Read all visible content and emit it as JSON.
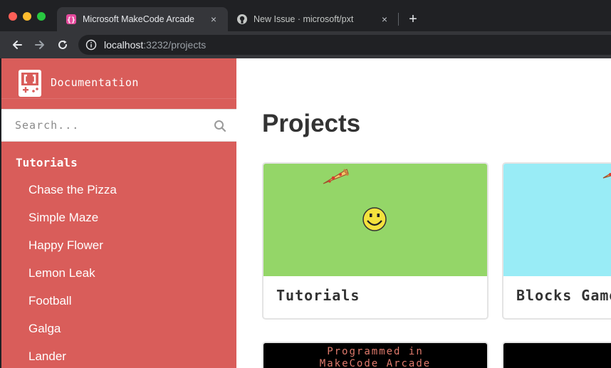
{
  "browser": {
    "tabs": [
      {
        "title": "Microsoft MakeCode Arcade",
        "active": true
      },
      {
        "title": "New Issue · microsoft/pxt",
        "active": false
      }
    ],
    "close_glyph": "×",
    "new_tab_glyph": "+",
    "url_host": "localhost",
    "url_rest": ":3232/projects"
  },
  "sidebar": {
    "brand_label": "Documentation",
    "search_placeholder": "Search...",
    "section_title": "Tutorials",
    "items": [
      {
        "label": "Chase the Pizza"
      },
      {
        "label": "Simple Maze"
      },
      {
        "label": "Happy Flower"
      },
      {
        "label": "Lemon Leak"
      },
      {
        "label": "Football"
      },
      {
        "label": "Galga"
      },
      {
        "label": "Lander"
      }
    ]
  },
  "main": {
    "title": "Projects",
    "cards": [
      {
        "label": "Tutorials",
        "color": "#94d668"
      },
      {
        "label": "Blocks Games",
        "color": "#99ecf6"
      }
    ],
    "promo": {
      "line1": "Programmed in",
      "line2": "MakeCode Arcade"
    }
  },
  "colors": {
    "sidebar_bg": "#d95d5a",
    "browser_bg": "#202124"
  }
}
